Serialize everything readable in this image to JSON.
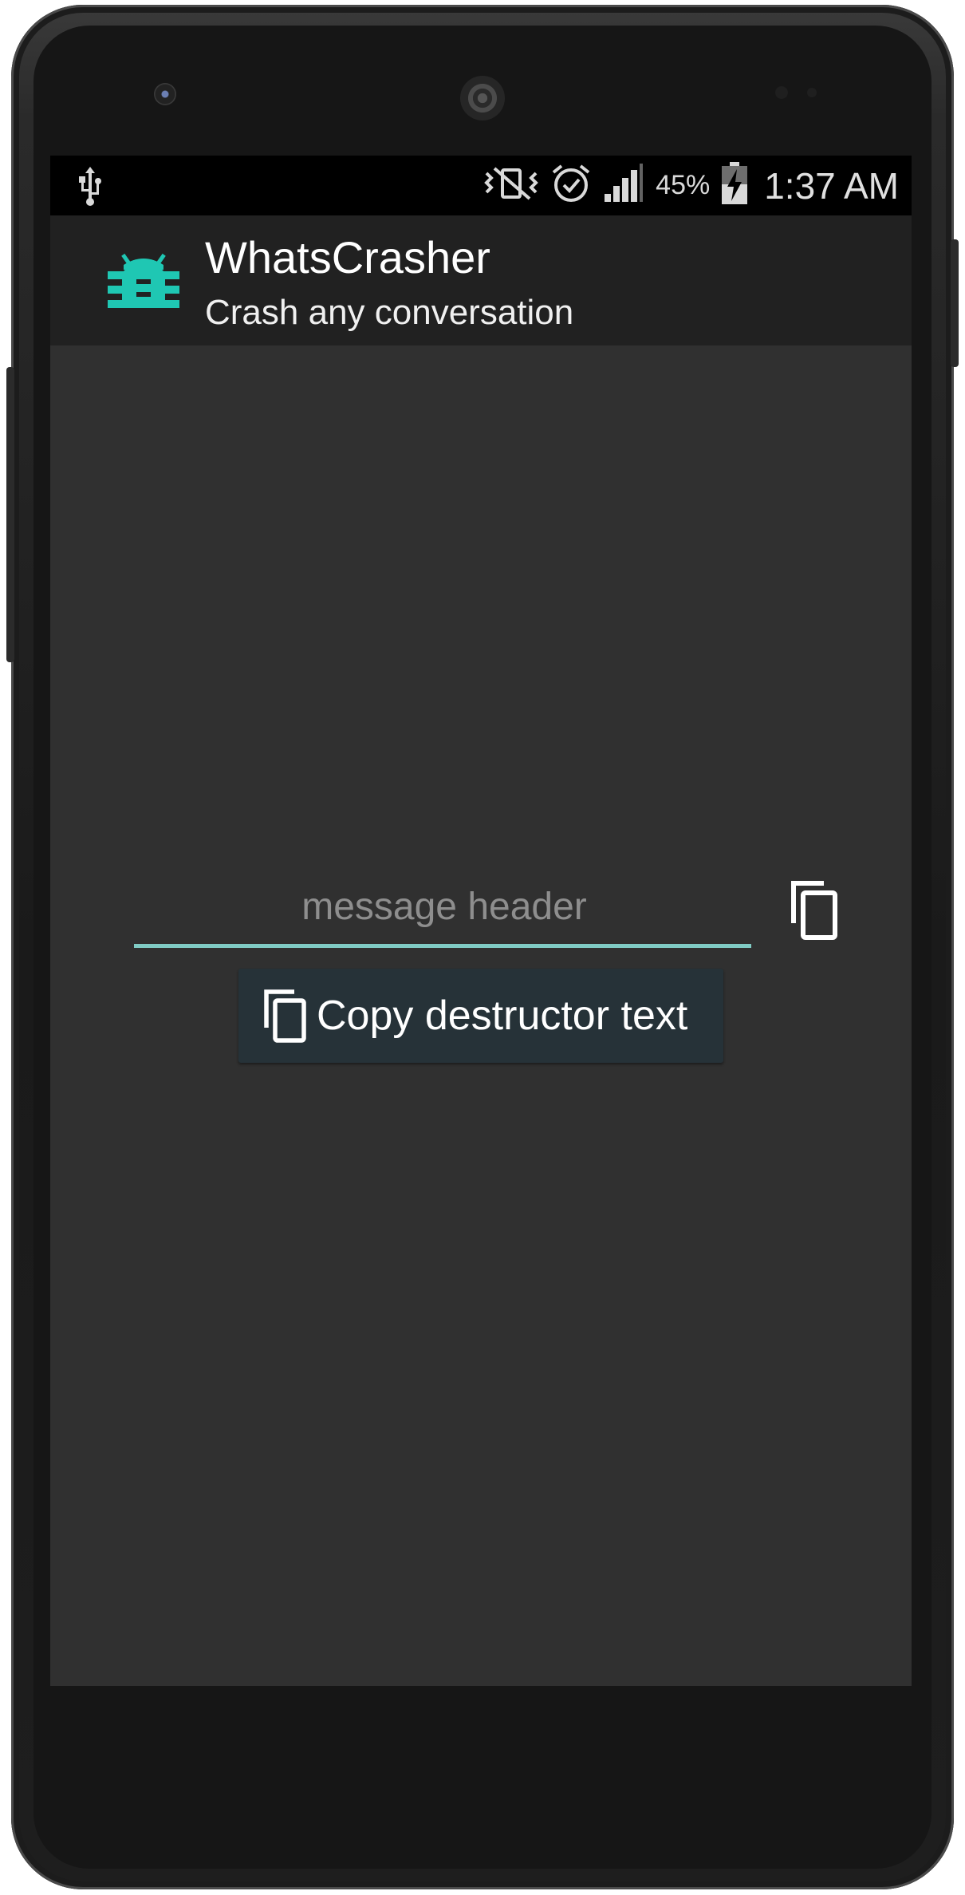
{
  "status_bar": {
    "left_icons": [
      "usb-icon"
    ],
    "right_icons": [
      "vibrate-icon",
      "alarm-icon",
      "signal-icon",
      "battery-charging-icon"
    ],
    "battery_percent": "45%",
    "time": "1:37 AM"
  },
  "action_bar": {
    "icon": "bug-icon",
    "title": "WhatsCrasher",
    "subtitle": "Crash any conversation"
  },
  "main": {
    "header_input": {
      "value": "",
      "placeholder": "message header"
    },
    "copy_icon": "copy-icon",
    "copy_button": {
      "icon": "copy-icon",
      "label": "Copy destructor text"
    }
  },
  "colors": {
    "accent": "#80cbc4",
    "app_icon": "#1fc7b3",
    "screen_bg": "#303030",
    "action_bar_bg": "#212121",
    "button_bg": "#263238"
  }
}
